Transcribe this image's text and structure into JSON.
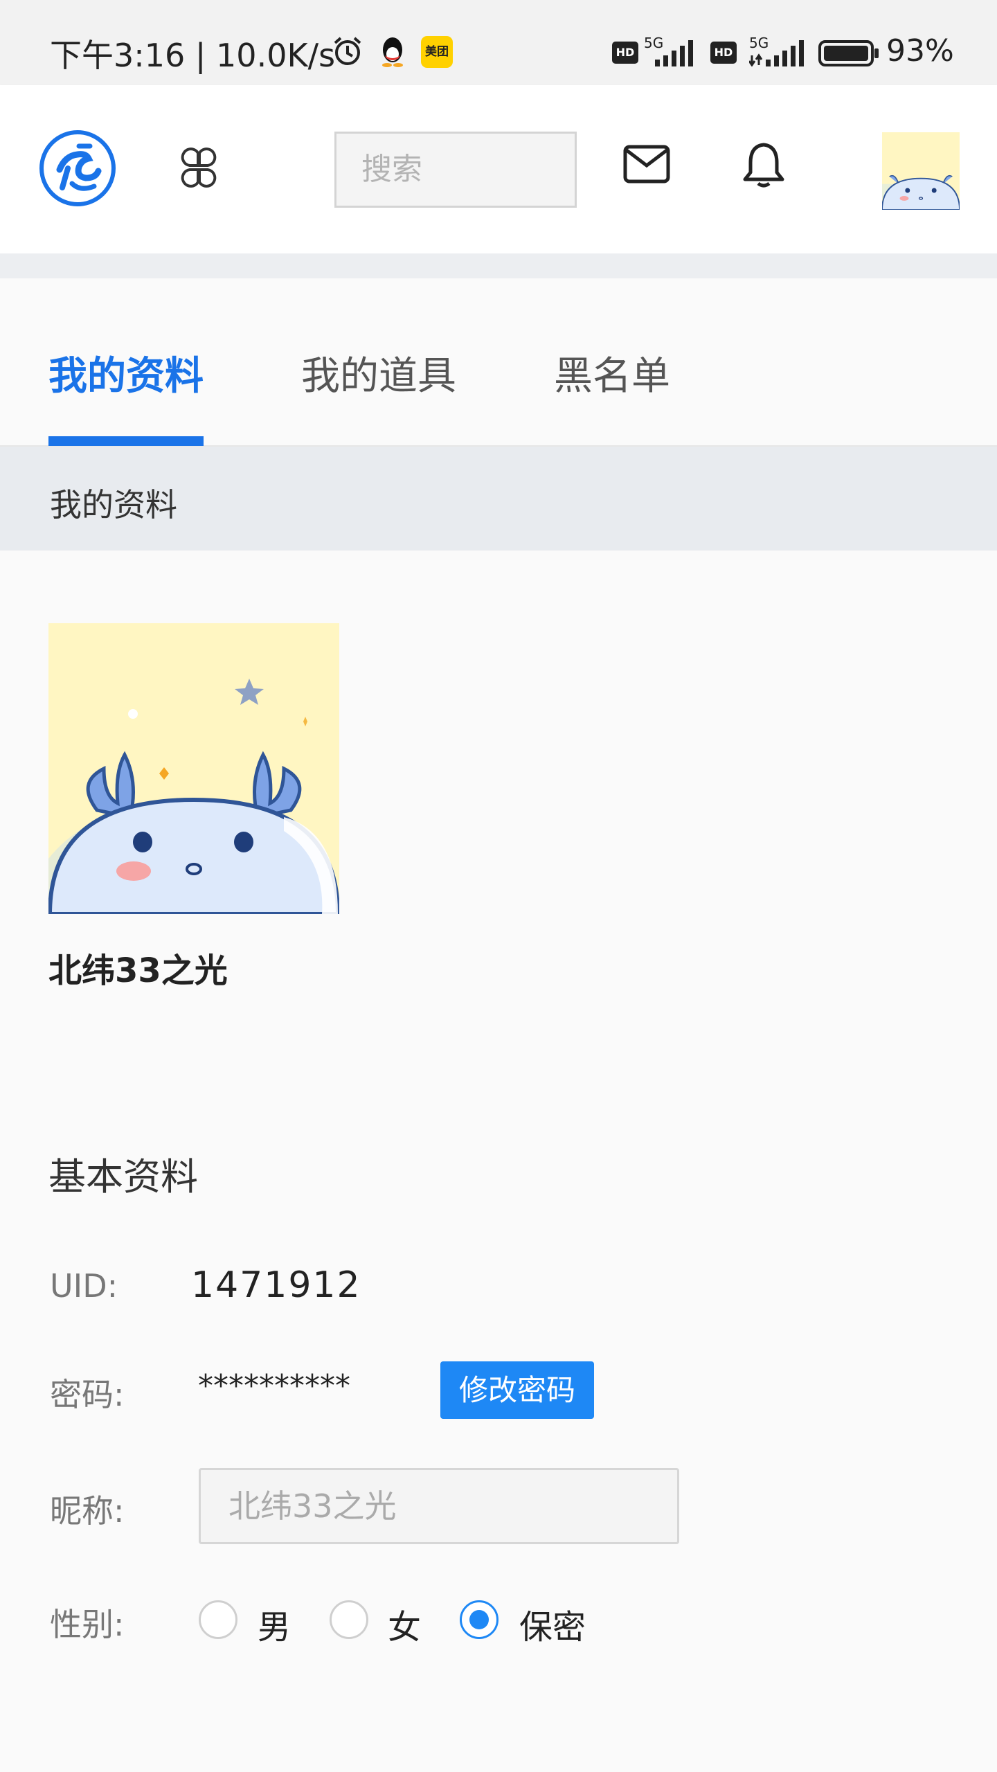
{
  "status_bar": {
    "time": "下午3:16 | 10.0K/s",
    "battery": "93%",
    "network_1": "5G",
    "network_2": "5G",
    "hd_1": "HD",
    "hd_2": "HD",
    "app_badge": "美团"
  },
  "header": {
    "search_placeholder": "搜索"
  },
  "tabs": [
    {
      "label": "我的资料",
      "active": true
    },
    {
      "label": "我的道具",
      "active": false
    },
    {
      "label": "黑名单",
      "active": false
    }
  ],
  "section_title": "我的资料",
  "profile": {
    "username": "北纬33之光"
  },
  "basic_info": {
    "title": "基本资料",
    "uid_label": "UID:",
    "uid_value": "1471912",
    "password_label": "密码:",
    "password_value": "**********",
    "change_password_button": "修改密码",
    "nickname_label": "昵称:",
    "nickname_placeholder": "北纬33之光",
    "gender_label": "性别:",
    "gender_options": [
      "男",
      "女",
      "保密"
    ],
    "gender_selected": "保密"
  },
  "colors": {
    "accent": "#1a73e8",
    "button": "#1e88f5",
    "avatar_bg": "#fff6c2"
  }
}
